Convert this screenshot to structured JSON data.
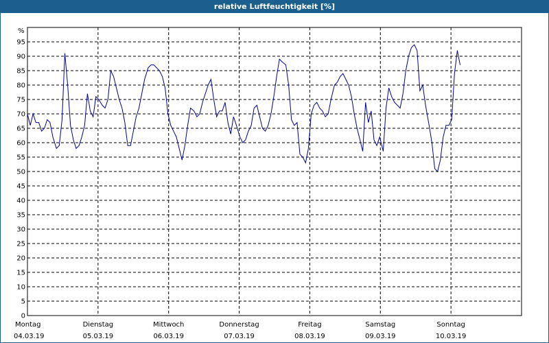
{
  "window": {
    "title": "relative Luftfeuchtigkeit [%]"
  },
  "colors": {
    "title_bar": "#1b5f8f",
    "series": "#000099",
    "grid": "#000000"
  },
  "chart_data": {
    "type": "line",
    "title": "relative Luftfeuchtigkeit [%]",
    "ylabel": "%",
    "ylim": [
      0,
      100
    ],
    "xlim": [
      0,
      7
    ],
    "yticks": [
      0,
      5,
      10,
      15,
      20,
      25,
      30,
      35,
      40,
      45,
      50,
      55,
      60,
      65,
      70,
      75,
      80,
      85,
      90,
      95
    ],
    "grid": true,
    "x_ticks": [
      {
        "day": "Montag",
        "date": "04.03.19"
      },
      {
        "day": "Dienstag",
        "date": "05.03.19"
      },
      {
        "day": "Mittwoch",
        "date": "06.03.19"
      },
      {
        "day": "Donnerstag",
        "date": "07.03.19"
      },
      {
        "day": "Freitag",
        "date": "08.03.19"
      },
      {
        "day": "Samstag",
        "date": "09.03.19"
      },
      {
        "day": "Sonntag",
        "date": "10.03.19"
      }
    ],
    "x": [
      0.0,
      0.04,
      0.08,
      0.12,
      0.16,
      0.2,
      0.24,
      0.28,
      0.32,
      0.36,
      0.41,
      0.45,
      0.49,
      0.53,
      0.57,
      0.61,
      0.65,
      0.69,
      0.73,
      0.77,
      0.81,
      0.85,
      0.89,
      0.93,
      0.97,
      1.01,
      1.06,
      1.1,
      1.14,
      1.18,
      1.22,
      1.26,
      1.3,
      1.34,
      1.38,
      1.42,
      1.46,
      1.5,
      1.54,
      1.58,
      1.62,
      1.66,
      1.71,
      1.75,
      1.79,
      1.83,
      1.87,
      1.91,
      1.95,
      1.99,
      2.03,
      2.07,
      2.11,
      2.15,
      2.19,
      2.23,
      2.27,
      2.31,
      2.36,
      2.4,
      2.44,
      2.48,
      2.52,
      2.56,
      2.6,
      2.64,
      2.68,
      2.72,
      2.76,
      2.8,
      2.84,
      2.88,
      2.92,
      2.96,
      3.01,
      3.05,
      3.09,
      3.13,
      3.17,
      3.21,
      3.25,
      3.29,
      3.33,
      3.37,
      3.41,
      3.45,
      3.49,
      3.53,
      3.57,
      3.61,
      3.66,
      3.7,
      3.74,
      3.78,
      3.82,
      3.86,
      3.9,
      3.94,
      3.98,
      4.02,
      4.06,
      4.1,
      4.14,
      4.18,
      4.22,
      4.26,
      4.3,
      4.35,
      4.39,
      4.43,
      4.47,
      4.51,
      4.55,
      4.59,
      4.63,
      4.67,
      4.71,
      4.75,
      4.79,
      4.83,
      4.87,
      4.91,
      4.95,
      4.99,
      5.04,
      5.08,
      5.12,
      5.16,
      5.2,
      5.24,
      5.28,
      5.32,
      5.36,
      5.4,
      5.44,
      5.48,
      5.52,
      5.56,
      5.6,
      5.64,
      5.69,
      5.73,
      5.77,
      5.81,
      5.85,
      5.89,
      5.93,
      5.97,
      6.01,
      6.05,
      6.09,
      6.13,
      6.17,
      6.21,
      6.25,
      6.29,
      6.34,
      6.38,
      6.42,
      6.46,
      6.5,
      6.54,
      6.58,
      6.62,
      6.66,
      6.7,
      6.74,
      6.78,
      6.82,
      6.86,
      6.9,
      6.94,
      6.99
    ],
    "values": [
      70,
      66,
      70,
      67,
      67,
      64,
      65,
      68,
      67,
      62,
      58,
      59,
      68,
      91,
      80,
      66,
      61,
      58,
      59,
      62,
      66,
      77,
      71,
      69,
      76,
      75,
      73,
      72,
      75,
      85,
      83,
      79,
      75,
      72,
      67,
      59,
      59,
      64,
      69,
      72,
      77,
      82,
      86,
      87,
      87,
      86,
      85,
      83,
      79,
      70,
      66,
      64,
      62,
      58,
      54,
      59,
      66,
      72,
      71,
      69,
      70,
      74,
      77,
      80,
      82,
      75,
      69,
      71,
      71,
      74,
      67,
      63,
      69,
      66,
      62,
      60,
      61,
      64,
      66,
      72,
      73,
      69,
      65,
      64,
      66,
      70,
      76,
      83,
      89,
      88,
      87,
      80,
      68,
      66,
      67,
      56,
      55,
      53,
      58,
      70,
      73,
      74,
      72,
      71,
      69,
      70,
      75,
      80,
      81,
      83,
      84,
      82,
      80,
      76,
      70,
      65,
      61,
      57,
      74,
      67,
      71,
      61,
      59,
      62,
      57,
      72,
      79,
      76,
      74,
      73,
      72,
      77,
      85,
      90,
      93,
      94,
      92,
      78,
      80,
      73,
      66,
      60,
      51,
      50,
      54,
      62,
      66,
      66,
      68,
      84,
      92,
      87
    ]
  }
}
